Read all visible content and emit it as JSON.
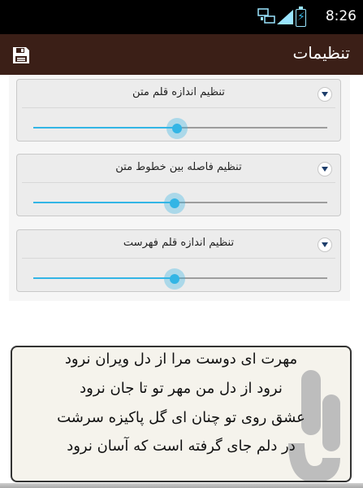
{
  "status_bar": {
    "time": "8:26",
    "network_icon": "network-activity-icon",
    "signal_icon": "signal-icon",
    "battery_icon": "battery-charging-icon"
  },
  "app_bar": {
    "title": "تنظیمات",
    "save_icon": "save-icon",
    "background": "#3b1f17"
  },
  "settings": [
    {
      "label": "تنظیم اندازه قلم متن",
      "value_percent": 49
    },
    {
      "label": "تنظیم فاصله بین خطوط متن",
      "value_percent": 48
    },
    {
      "label": "تنظیم اندازه قلم فهرست",
      "value_percent": 48
    }
  ],
  "preview": {
    "lines": [
      "مهرت ای دوست مرا از دل ویران نرود",
      "نرود از دل من مهر تو تا جان نرود",
      "عشق روی تو چنان ای گل پاکیزه سرشت",
      "در دلم جای گرفته است که آسان نرود"
    ],
    "watermark_icon": "app-logo-watermark"
  },
  "accent": "#33b5e5"
}
